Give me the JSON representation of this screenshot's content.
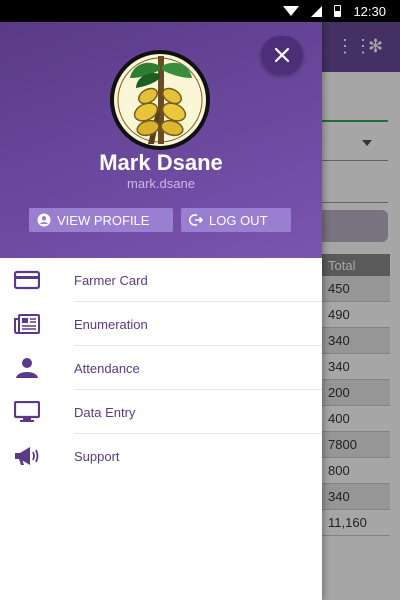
{
  "status_bar": {
    "time": "12:30"
  },
  "user": {
    "name": "Mark Dsane",
    "handle": "mark.dsane"
  },
  "header_buttons": {
    "view_profile": "VIEW PROFILE",
    "log_out": "LOG OUT"
  },
  "menu": [
    {
      "label": "Farmer Card",
      "icon": "card-icon"
    },
    {
      "label": "Enumeration",
      "icon": "newspaper-icon"
    },
    {
      "label": "Attendance",
      "icon": "person-icon"
    },
    {
      "label": "Data Entry",
      "icon": "monitor-icon"
    },
    {
      "label": "Support",
      "icon": "megaphone-icon"
    }
  ],
  "background_table": {
    "header": "Total",
    "rows": [
      "450",
      "490",
      "340",
      "340",
      "200",
      "400",
      "7800",
      "800",
      "340",
      "11,160"
    ]
  },
  "colors": {
    "primary": "#5a3a88",
    "accent": "#9a7fd0",
    "header_gradient_end": "#7a55b0"
  }
}
